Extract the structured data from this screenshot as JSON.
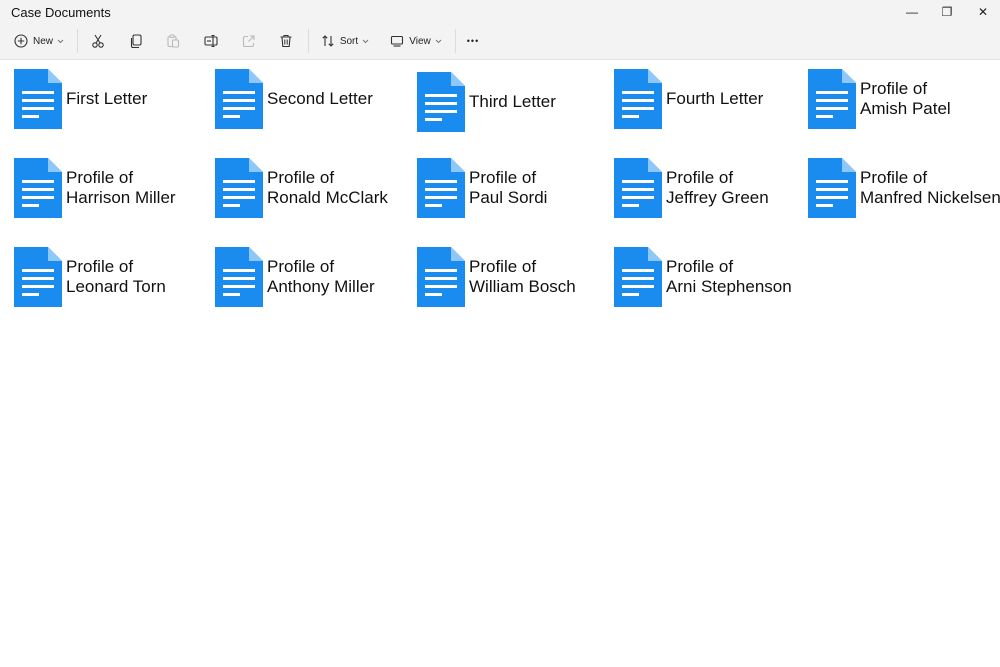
{
  "window": {
    "title": "Case Documents",
    "controls": [
      {
        "name": "minimize",
        "glyph": "—"
      },
      {
        "name": "restore",
        "glyph": "❐"
      },
      {
        "name": "close",
        "glyph": "✕"
      }
    ]
  },
  "toolbar": {
    "new_label": "New",
    "sort_label": "Sort",
    "view_label": "View",
    "more_label": "•••",
    "icons": [
      "new-icon",
      "cut-icon",
      "copy-icon",
      "paste-icon",
      "rename-icon",
      "share-icon",
      "delete-icon",
      "sort-icon",
      "view-icon",
      "more-icon"
    ]
  },
  "colors": {
    "doc_blue": "#1a8cf0",
    "doc_fold": "#8ec7fa",
    "toolbar_bg": "#f3f3f3"
  },
  "files": [
    {
      "lines": [
        "First Letter"
      ]
    },
    {
      "lines": [
        "Second Letter"
      ]
    },
    {
      "lines": [
        "Third Letter"
      ]
    },
    {
      "lines": [
        "Fourth Letter"
      ]
    },
    {
      "lines": [
        "Profile of",
        "Amish Patel"
      ]
    },
    {
      "lines": [
        "Profile of",
        "Harrison Miller"
      ]
    },
    {
      "lines": [
        "Profile of",
        "Ronald McClark"
      ]
    },
    {
      "lines": [
        "Profile of",
        "Paul Sordi"
      ]
    },
    {
      "lines": [
        "Profile of",
        "Jeffrey Green"
      ]
    },
    {
      "lines": [
        "Profile of",
        "Manfred Nickelsen"
      ]
    },
    {
      "lines": [
        "Profile of",
        "Leonard Torn"
      ]
    },
    {
      "lines": [
        "Profile of",
        "Anthony Miller"
      ]
    },
    {
      "lines": [
        "Profile of",
        "William Bosch"
      ]
    },
    {
      "lines": [
        "Profile of",
        "Arni Stephenson"
      ]
    }
  ]
}
